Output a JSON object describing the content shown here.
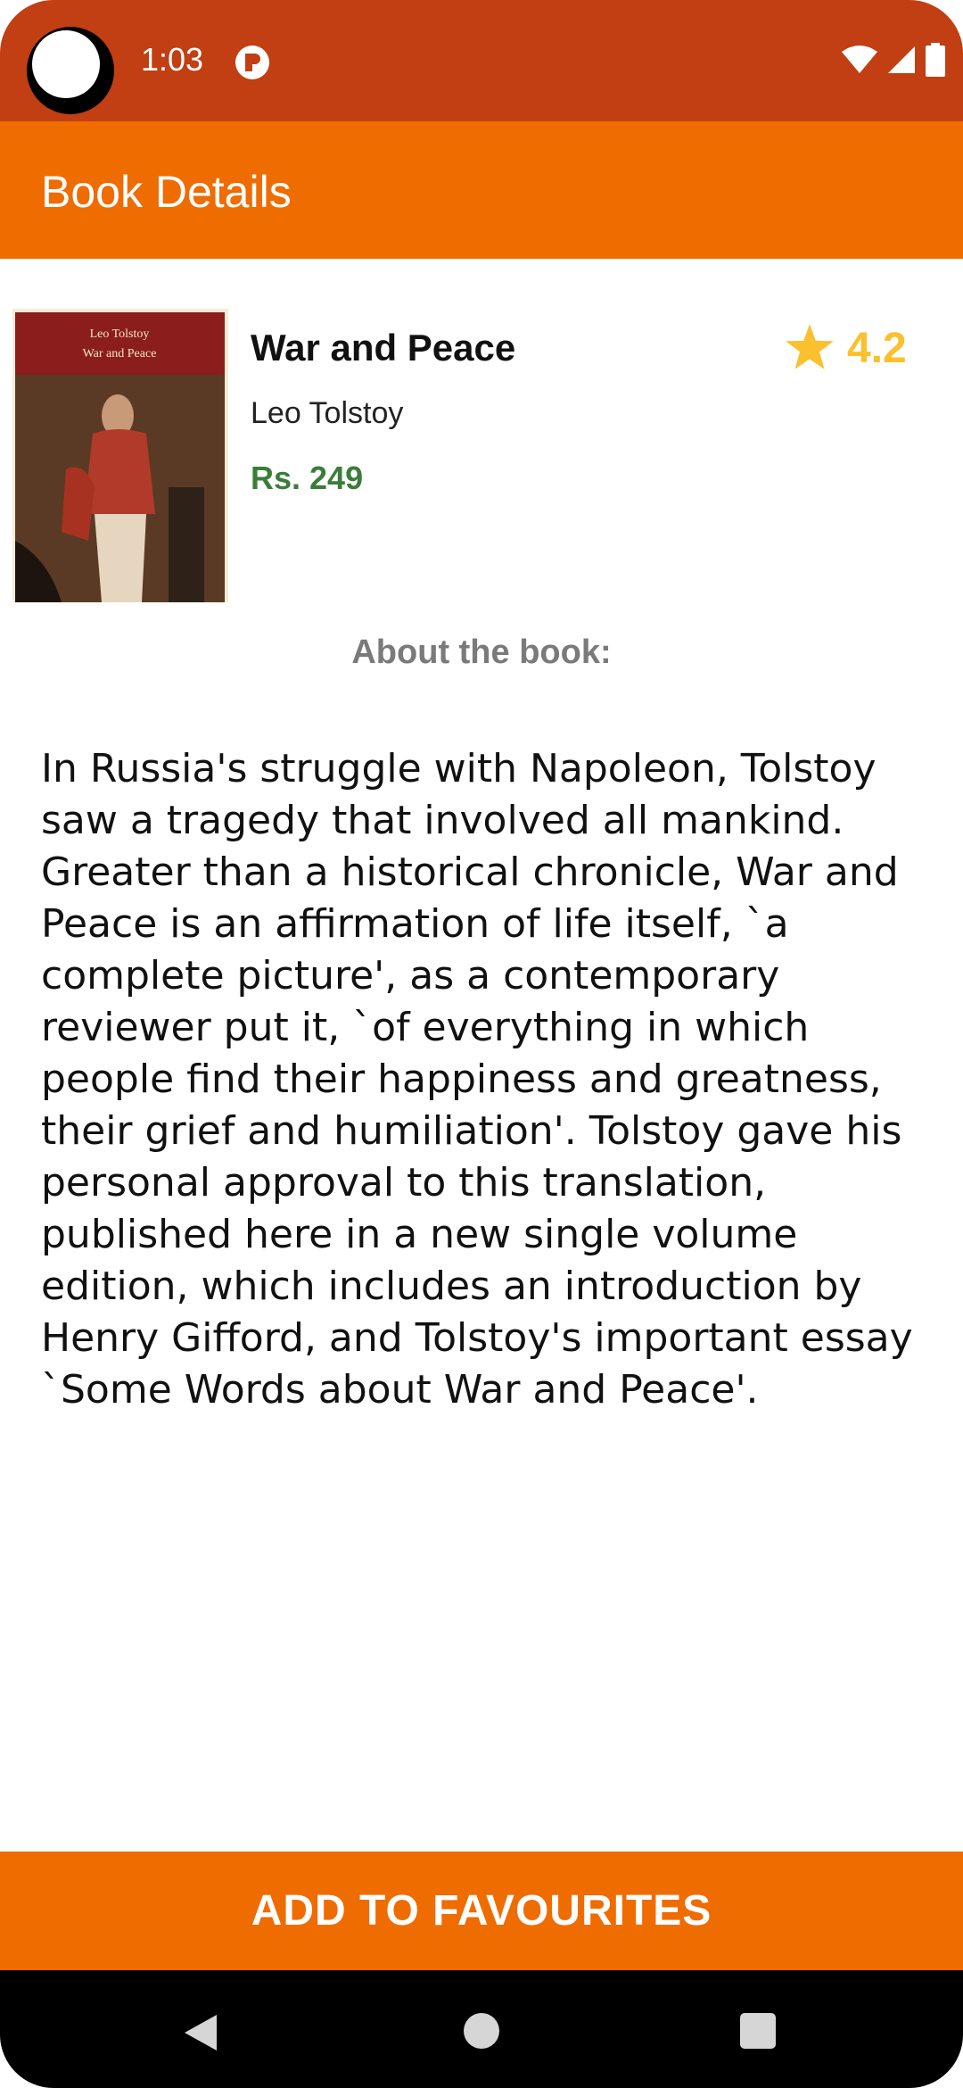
{
  "status_bar": {
    "time": "1:03",
    "icons": [
      "app-notification-icon",
      "wifi-icon",
      "signal-icon",
      "battery-icon"
    ]
  },
  "app_bar": {
    "title": "Book Details"
  },
  "book": {
    "cover": {
      "line1": "Leo Tolstoy",
      "line2": "War and Peace"
    },
    "title": "War and Peace",
    "author": "Leo Tolstoy",
    "price": "Rs. 249",
    "rating": "4.2",
    "rating_icon": "star-icon",
    "rating_color": "#fbc02d"
  },
  "about": {
    "label": "About the book:",
    "description": "In Russia's struggle with Napoleon, Tolstoy saw a tragedy that involved all mankind. Greater than a historical chronicle, War and Peace is an affirmation of life itself, `a complete picture', as a contemporary reviewer put it, `of everything in which people find their happiness and greatness, their grief and humiliation'. Tolstoy gave his personal approval to this translation, published here in a new single volume edition, which includes an introduction by Henry Gifford, and Tolstoy's important essay `Some Words about War and Peace'."
  },
  "actions": {
    "add_favourites": "ADD TO FAVOURITES"
  },
  "colors": {
    "status_bar": "#c13f12",
    "app_bar": "#ef6c00",
    "price": "#3a7d3a",
    "accent": "#ef6c00"
  }
}
